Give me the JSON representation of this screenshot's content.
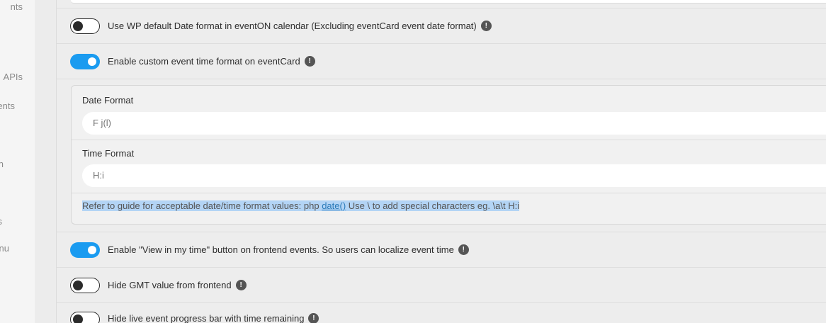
{
  "sidebar": {
    "items": [
      {
        "label": "nts"
      },
      {
        "label": "APIs"
      },
      {
        "label": "ents"
      },
      {
        "label": "n"
      },
      {
        "label": "s"
      },
      {
        "label": "nu"
      }
    ]
  },
  "settings": {
    "wp_date_format": {
      "label": "Use WP default Date format in eventON calendar (Excluding eventCard event date format)",
      "enabled": false
    },
    "custom_time_format": {
      "label": "Enable custom event time format on eventCard",
      "enabled": true
    },
    "date_format": {
      "label": "Date Format",
      "value": "",
      "placeholder": "F j(l)"
    },
    "time_format": {
      "label": "Time Format",
      "value": "",
      "placeholder": "H:i"
    },
    "guide": {
      "prefix": "Refer to guide for acceptable date/time format values: php ",
      "link": "date()",
      "suffix": " Use \\ to add special characters eg. \\a\\t H:i"
    },
    "view_in_my_time": {
      "label": "Enable \"View in my time\" button on frontend events. So users can localize event time",
      "enabled": true
    },
    "hide_gmt": {
      "label": "Hide GMT value from frontend",
      "enabled": false
    },
    "hide_progress": {
      "label": "Hide live event progress bar with time remaining",
      "enabled": false
    }
  },
  "info_glyph": "!",
  "colors": {
    "toggle_on": "#1a9bf0",
    "link": "#2a7ab8",
    "selection": "#b3d4f5"
  }
}
